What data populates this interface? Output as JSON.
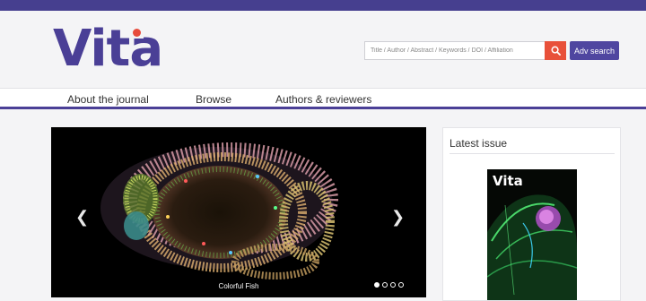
{
  "brand": {
    "name": "Vita",
    "dot_color": "#e74c3c",
    "primary_color": "#4a3f96"
  },
  "search": {
    "placeholder": "Title / Author / Abstract / Keywords / DOI / Affiliation",
    "button_icon": "search-icon",
    "adv_label": "Adv search"
  },
  "nav": {
    "items": [
      "About the journal",
      "Browse",
      "Authors & reviewers"
    ]
  },
  "carousel": {
    "caption": "Colorful Fish",
    "slide_count": 4,
    "active_index": 0,
    "prev_icon": "chevron-left-icon",
    "next_icon": "chevron-right-icon"
  },
  "latest": {
    "title": "Latest issue",
    "cover_title": "Vita"
  }
}
